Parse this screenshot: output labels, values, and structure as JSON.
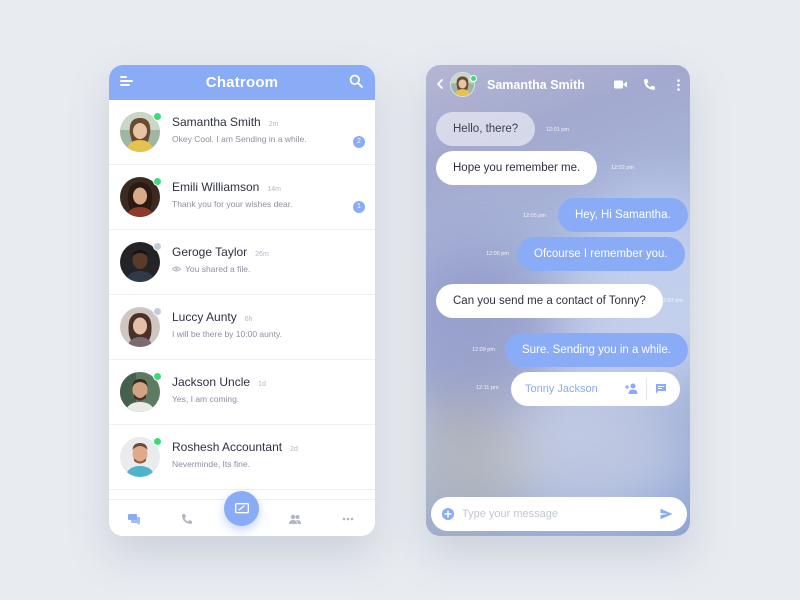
{
  "chatroom": {
    "title": "Chatroom",
    "contacts": [
      {
        "name": "Samantha Smith",
        "time": "2m",
        "message": "Okey Cool. I am Sending in a while.",
        "badge": "2",
        "status": "online"
      },
      {
        "name": "Emili Williamson",
        "time": "14m",
        "message": "Thank you for your wishes dear.",
        "badge": "1",
        "status": "online"
      },
      {
        "name": "Geroge Taylor",
        "time": "26m",
        "message": "You shared a file.",
        "badge": "",
        "status": "offline"
      },
      {
        "name": "Luccy Aunty",
        "time": "6h",
        "message": "I will be there by 10:00 aunty.",
        "badge": "",
        "status": "offline"
      },
      {
        "name": "Jackson Uncle",
        "time": "1d",
        "message": "Yes, I am coming.",
        "badge": "",
        "status": "online"
      },
      {
        "name": "Roshesh Accountant",
        "time": "2d",
        "message": "Neverminde, Its fine.",
        "badge": "",
        "status": "online"
      }
    ],
    "bottom_nav": [
      "chats-icon",
      "call-icon",
      "new-chat-icon",
      "contacts-icon",
      "more-icon"
    ]
  },
  "conversation": {
    "contact_name": "Samantha Smith",
    "messages": [
      {
        "text": "Hello, there?",
        "time": "12:01 pm",
        "direction": "in"
      },
      {
        "text": "Hope you remember me.",
        "time": "12:02 pm",
        "direction": "in"
      },
      {
        "text": "Hey, Hi Samantha.",
        "time": "12:05 pm",
        "direction": "out"
      },
      {
        "text": "Ofcourse I remember you.",
        "time": "12:05 pm",
        "direction": "out"
      },
      {
        "text": "Can you send me a contact of Tonny?",
        "time": "12:07 pm",
        "direction": "in"
      },
      {
        "text": "Sure. Sending you in a while.",
        "time": "12:09 pm",
        "direction": "out"
      }
    ],
    "shared_contact": {
      "name": "Tonny Jackson",
      "time": "12:11 pm"
    },
    "input_placeholder": "Type your message"
  },
  "colors": {
    "accent": "#8aabf5",
    "online": "#3fd97a",
    "offline": "#c8ccd6",
    "background": "#e8ebf0"
  }
}
